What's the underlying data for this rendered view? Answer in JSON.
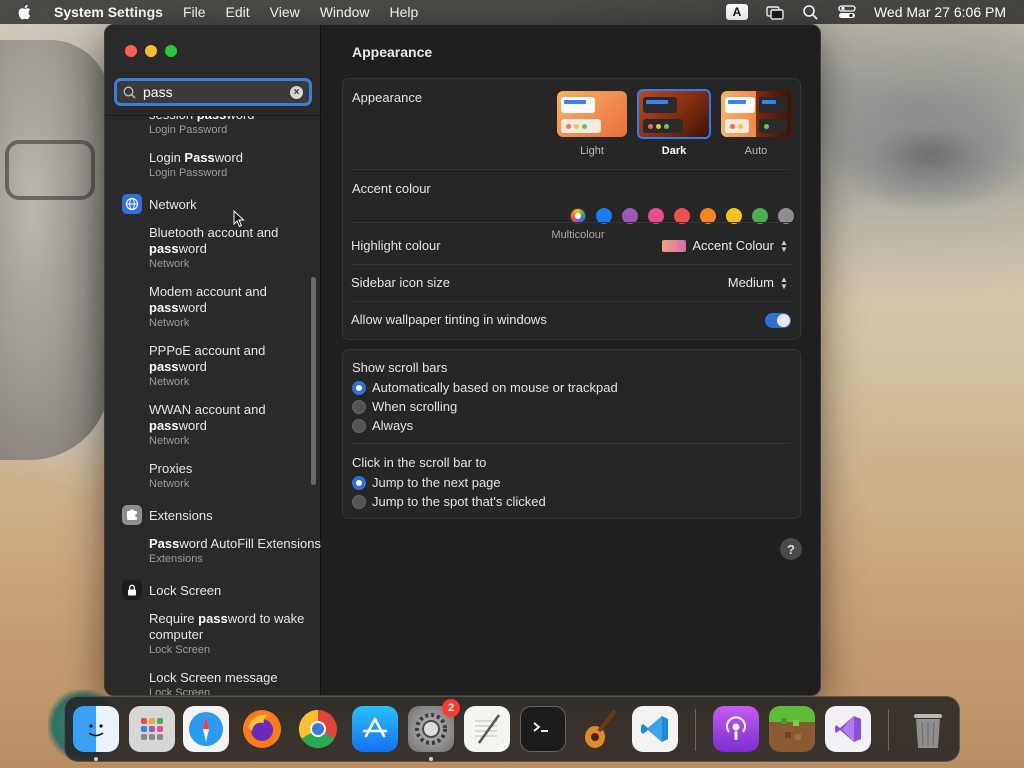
{
  "menubar": {
    "app_name": "System Settings",
    "items": [
      "File",
      "Edit",
      "View",
      "Window",
      "Help"
    ],
    "input_source": "A",
    "clock": "Wed Mar 27  6:06 PM"
  },
  "search": {
    "value": "pass"
  },
  "sidebar": {
    "results_top": [
      {
        "title_pre": "session ",
        "title_match": "pass",
        "title_post": "word",
        "sub": "Login Password"
      },
      {
        "title_pre": "Login ",
        "title_match": "Pass",
        "title_post": "word",
        "sub": "Login Password"
      }
    ],
    "sections": [
      {
        "label": "Network",
        "results": [
          {
            "title_pre": "Bluetooth account and ",
            "title_match": "pass",
            "title_post": "word",
            "sub": "Network"
          },
          {
            "title_pre": "Modem account and ",
            "title_match": "pass",
            "title_post": "word",
            "sub": "Network"
          },
          {
            "title_pre": "PPPoE account and ",
            "title_match": "pass",
            "title_post": "word",
            "sub": "Network"
          },
          {
            "title_pre": "WWAN account and ",
            "title_match": "pass",
            "title_post": "word",
            "sub": "Network"
          },
          {
            "title_pre": "Proxies",
            "title_match": "",
            "title_post": "",
            "sub": "Network"
          }
        ]
      },
      {
        "label": "Extensions",
        "results": [
          {
            "title_pre": "",
            "title_match": "Pass",
            "title_post": "word AutoFill Extensions",
            "sub": "Extensions"
          }
        ]
      },
      {
        "label": "Lock Screen",
        "results": [
          {
            "title_pre": "Require ",
            "title_match": "pass",
            "title_post": "word to wake computer",
            "sub": "Lock Screen"
          },
          {
            "title_pre": "Lock Screen message",
            "title_match": "",
            "title_post": "",
            "sub": "Lock Screen"
          }
        ]
      }
    ]
  },
  "main": {
    "title": "Appearance",
    "appearance": {
      "label": "Appearance",
      "options": [
        "Light",
        "Dark",
        "Auto"
      ],
      "selected": "Dark"
    },
    "accent": {
      "label": "Accent colour",
      "caption": "Multicolour",
      "colors": [
        "multicolour",
        "#1a7cf5",
        "#9b59b6",
        "#e74c8b",
        "#ee4f4f",
        "#f7841f",
        "#f5c31a",
        "#4cae4c",
        "#8e8e8e"
      ]
    },
    "highlight": {
      "label": "Highlight colour",
      "value": "Accent Colour"
    },
    "sidebar_icon": {
      "label": "Sidebar icon size",
      "value": "Medium"
    },
    "wallpaper_tinting": {
      "label": "Allow wallpaper tinting in windows",
      "enabled": true
    },
    "scroll_bars": {
      "label": "Show scroll bars",
      "options": [
        "Automatically based on mouse or trackpad",
        "When scrolling",
        "Always"
      ],
      "selected_index": 0
    },
    "click_scroll": {
      "label": "Click in the scroll bar to",
      "options": [
        "Jump to the next page",
        "Jump to the spot that's clicked"
      ],
      "selected_index": 0
    },
    "help": "?"
  },
  "dock": {
    "apps": [
      "finder",
      "launchpad",
      "safari",
      "firefox",
      "chrome",
      "app-store",
      "system-settings",
      "textedit",
      "terminal",
      "garageband",
      "vscode",
      "podcasts",
      "minecraft",
      "visual-studio",
      "trash"
    ],
    "system_settings_badge": "2"
  }
}
